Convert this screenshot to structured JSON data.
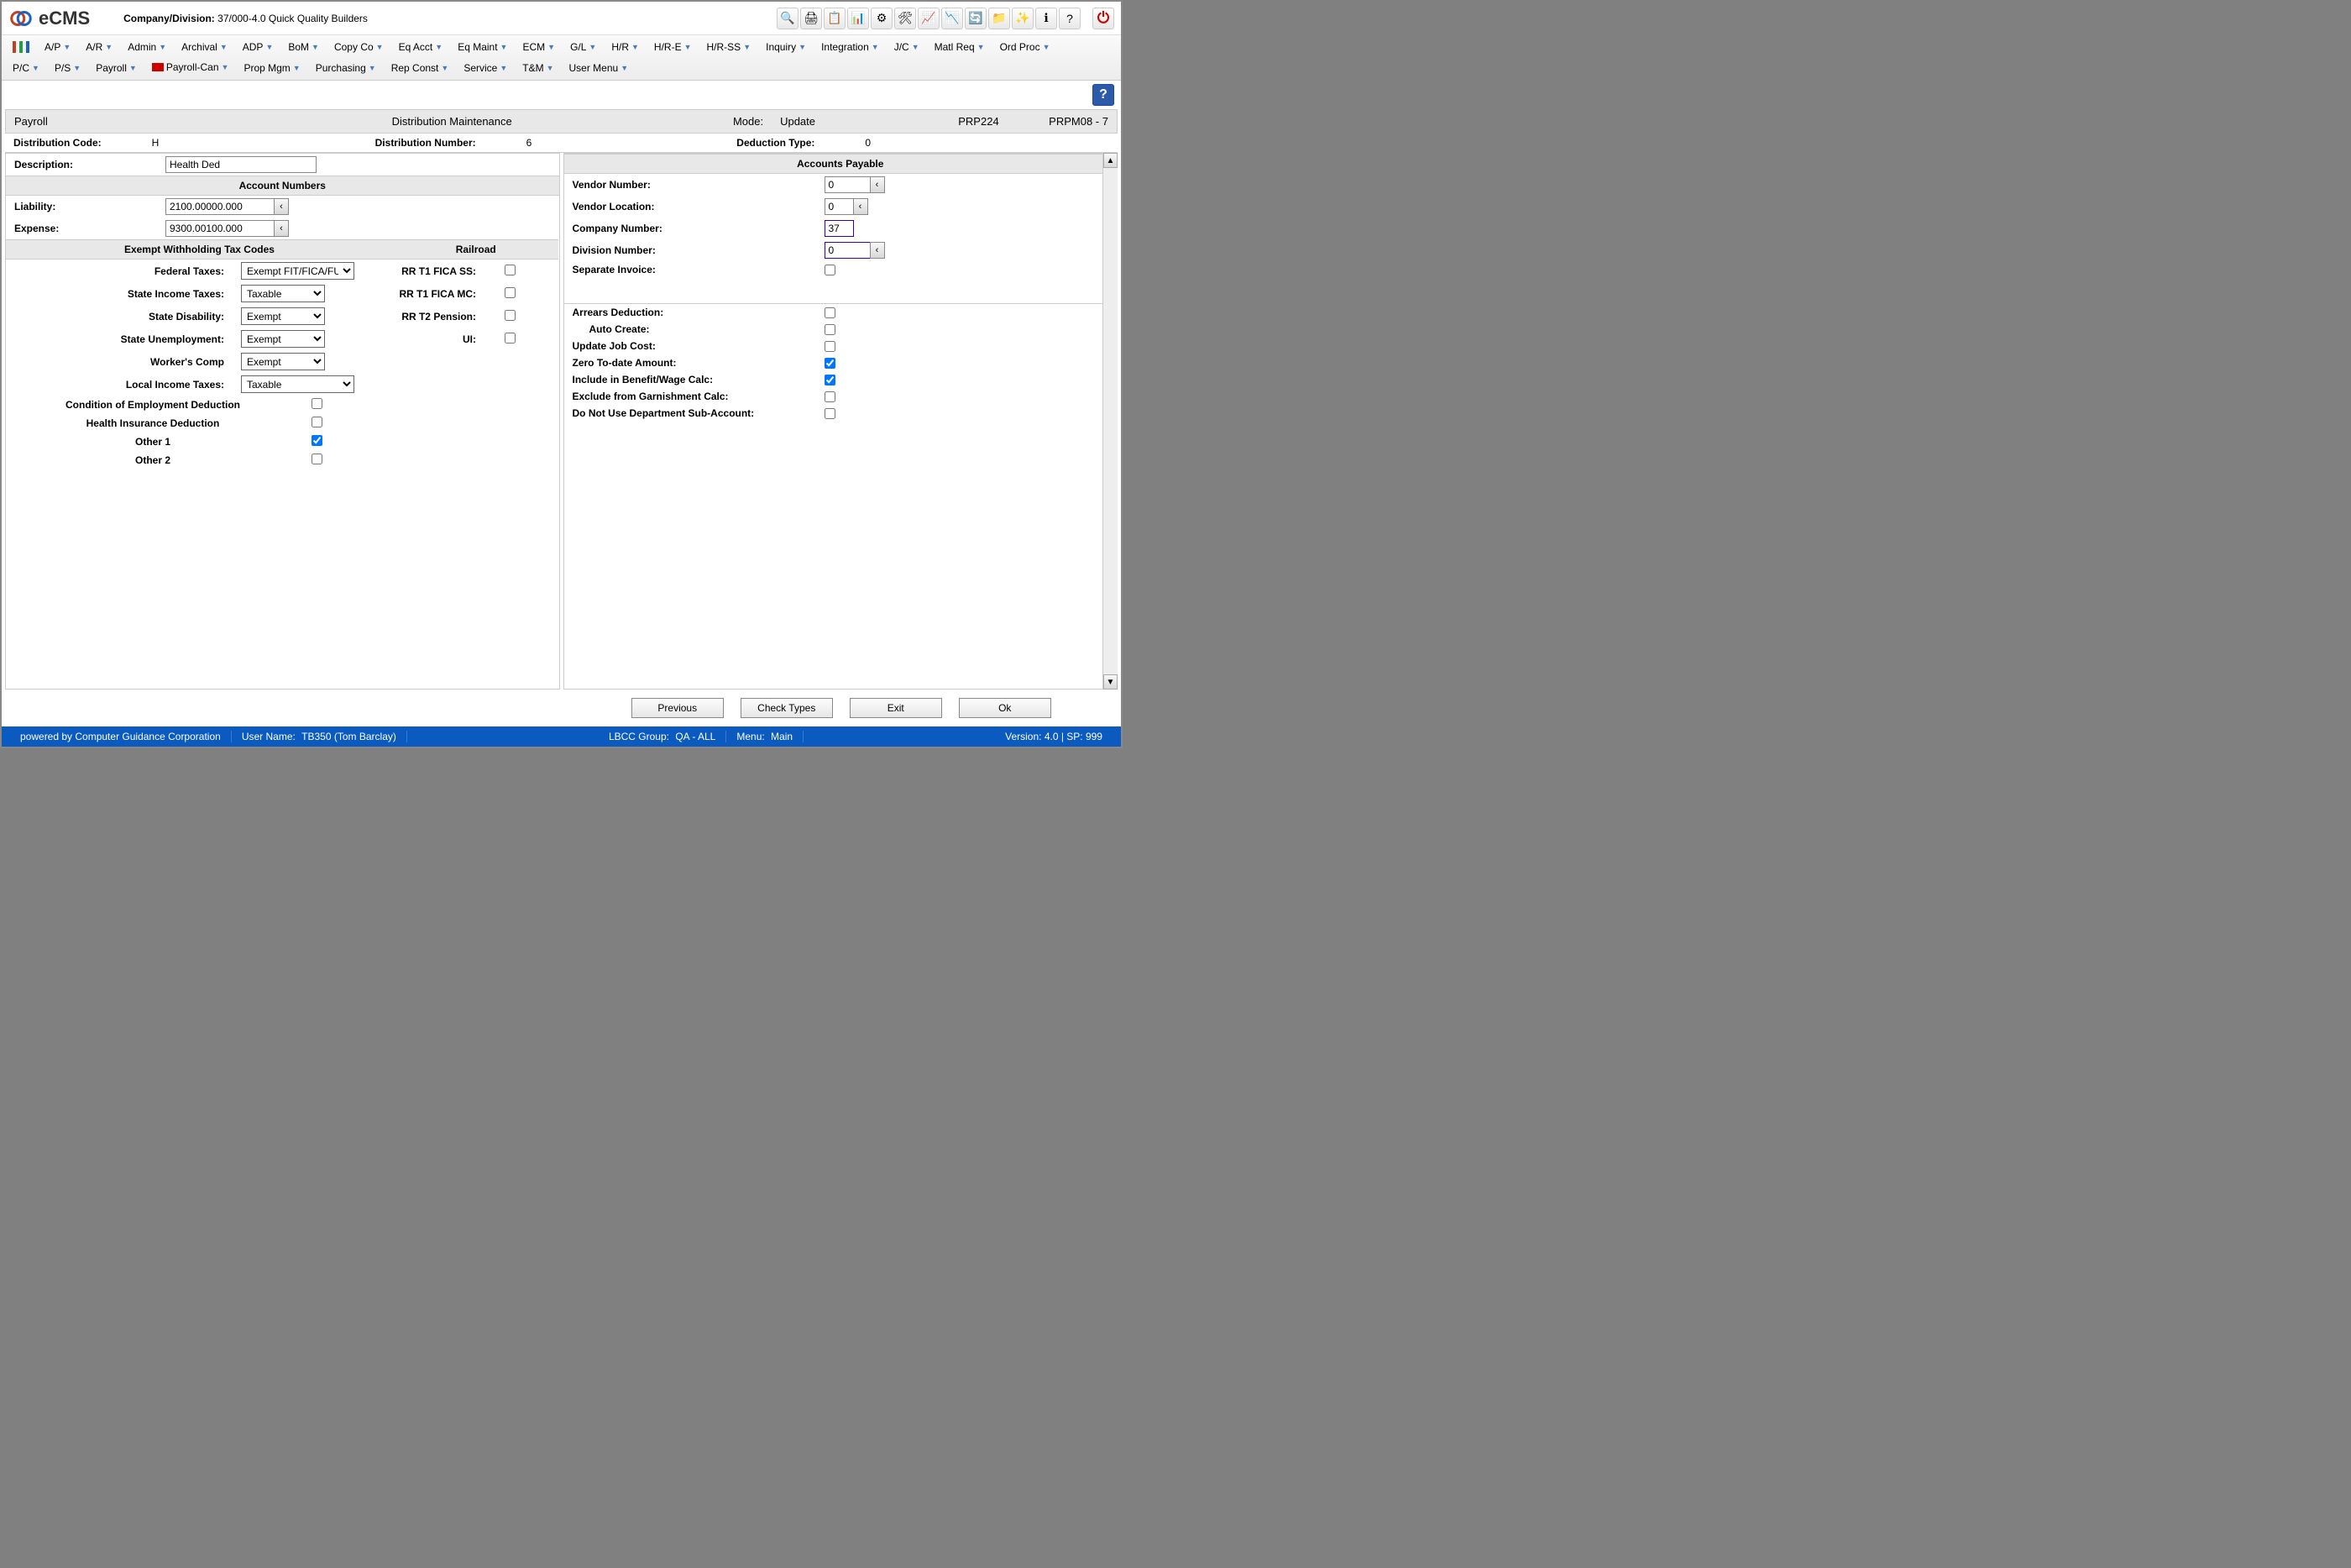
{
  "header": {
    "logo_text": "eCMS",
    "company_label": "Company/Division:",
    "company_value": "37/000-4.0 Quick Quality Builders"
  },
  "toolbar_icons": [
    {
      "name": "search-icon",
      "glyph": "🔍"
    },
    {
      "name": "print-icon",
      "glyph": "🖨"
    },
    {
      "name": "notes-icon",
      "glyph": "📋"
    },
    {
      "name": "chart-icon",
      "glyph": "📊"
    },
    {
      "name": "settings-icon",
      "glyph": "⚙"
    },
    {
      "name": "tools-icon",
      "glyph": "🛠"
    },
    {
      "name": "trend-up-icon",
      "glyph": "📈"
    },
    {
      "name": "trend-down-icon",
      "glyph": "📉"
    },
    {
      "name": "refresh-icon",
      "glyph": "🔄"
    },
    {
      "name": "folder-icon",
      "glyph": "📁"
    },
    {
      "name": "wizard-icon",
      "glyph": "✨"
    },
    {
      "name": "info-icon",
      "glyph": "ℹ"
    },
    {
      "name": "help-icon",
      "glyph": "?"
    }
  ],
  "menus_row1": [
    "A/P",
    "A/R",
    "Admin",
    "Archival",
    "ADP",
    "BoM",
    "Copy Co",
    "Eq Acct",
    "Eq Maint",
    "ECM",
    "G/L",
    "H/R",
    "H/R-E",
    "H/R-SS",
    "Inquiry",
    "Integration",
    "J/C",
    "Matl Req",
    "Ord Proc"
  ],
  "menus_row2": [
    "P/C",
    "P/S",
    "Payroll",
    "Payroll-Can",
    "Prop Mgm",
    "Purchasing",
    "Rep Const",
    "Service",
    "T&M",
    "User Menu"
  ],
  "titlebar": {
    "module": "Payroll",
    "screen": "Distribution Maintenance",
    "mode_label": "Mode:",
    "mode_value": "Update",
    "code1": "PRP224",
    "code2": "PRPM08 - 7"
  },
  "header_row": {
    "dist_code_label": "Distribution Code:",
    "dist_code_value": "H",
    "dist_num_label": "Distribution Number:",
    "dist_num_value": "6",
    "ded_type_label": "Deduction Type:",
    "ded_type_value": "0"
  },
  "left_panel": {
    "description_label": "Description:",
    "description_value": "Health Ded",
    "account_numbers_header": "Account Numbers",
    "liability_label": "Liability:",
    "liability_value": "2100.00000.000",
    "expense_label": "Expense:",
    "expense_value": "9300.00100.000",
    "exempt_header": "Exempt Withholding Tax Codes",
    "railroad_header": "Railroad",
    "tax_rows": [
      {
        "label": "Federal Taxes:",
        "value": "Exempt FIT/FICA/FUTA"
      },
      {
        "label": "State Income Taxes:",
        "value": "Taxable"
      },
      {
        "label": "State Disability:",
        "value": "Exempt"
      },
      {
        "label": "State Unemployment:",
        "value": "Exempt"
      },
      {
        "label": "Worker's Comp",
        "value": "Exempt"
      },
      {
        "label": "Local Income Taxes:",
        "value": "Taxable"
      }
    ],
    "rr_rows": [
      {
        "label": "RR T1 FICA SS:"
      },
      {
        "label": "RR T1 FICA MC:"
      },
      {
        "label": "RR T2 Pension:"
      },
      {
        "label": "UI:"
      }
    ],
    "bottom_checks": [
      {
        "label": "Condition of Employment Deduction",
        "checked": false
      },
      {
        "label": "Health Insurance Deduction",
        "checked": false
      },
      {
        "label": "Other 1",
        "checked": true
      },
      {
        "label": "Other 2",
        "checked": false
      }
    ]
  },
  "right_panel": {
    "ap_header": "Accounts Payable",
    "vendor_number_label": "Vendor Number:",
    "vendor_number_value": "0",
    "vendor_location_label": "Vendor Location:",
    "vendor_location_value": "0",
    "company_number_label": "Company Number:",
    "company_number_value": "37",
    "division_number_label": "Division Number:",
    "division_number_value": "0",
    "separate_invoice_label": "Separate Invoice:",
    "flags": [
      {
        "label": "Arrears Deduction:",
        "checked": false
      },
      {
        "label": "Auto Create:",
        "checked": false,
        "indent": true
      },
      {
        "label": "Update Job Cost:",
        "checked": false
      },
      {
        "label": "Zero To-date Amount:",
        "checked": true
      },
      {
        "label": "Include in Benefit/Wage Calc:",
        "checked": true
      },
      {
        "label": "Exclude from Garnishment Calc:",
        "checked": false
      },
      {
        "label": "Do Not Use Department Sub-Account:",
        "checked": false
      }
    ]
  },
  "buttons": {
    "previous": "Previous",
    "check_types": "Check Types",
    "exit": "Exit",
    "ok": "Ok"
  },
  "statusbar": {
    "powered": "powered by Computer Guidance Corporation",
    "user_label": "User Name:",
    "user_value": "TB350 (Tom Barclay)",
    "lbcc_label": "LBCC Group:",
    "lbcc_value": "QA - ALL",
    "menu_label": "Menu:",
    "menu_value": "Main",
    "version": "Version: 4.0 | SP: 999"
  }
}
